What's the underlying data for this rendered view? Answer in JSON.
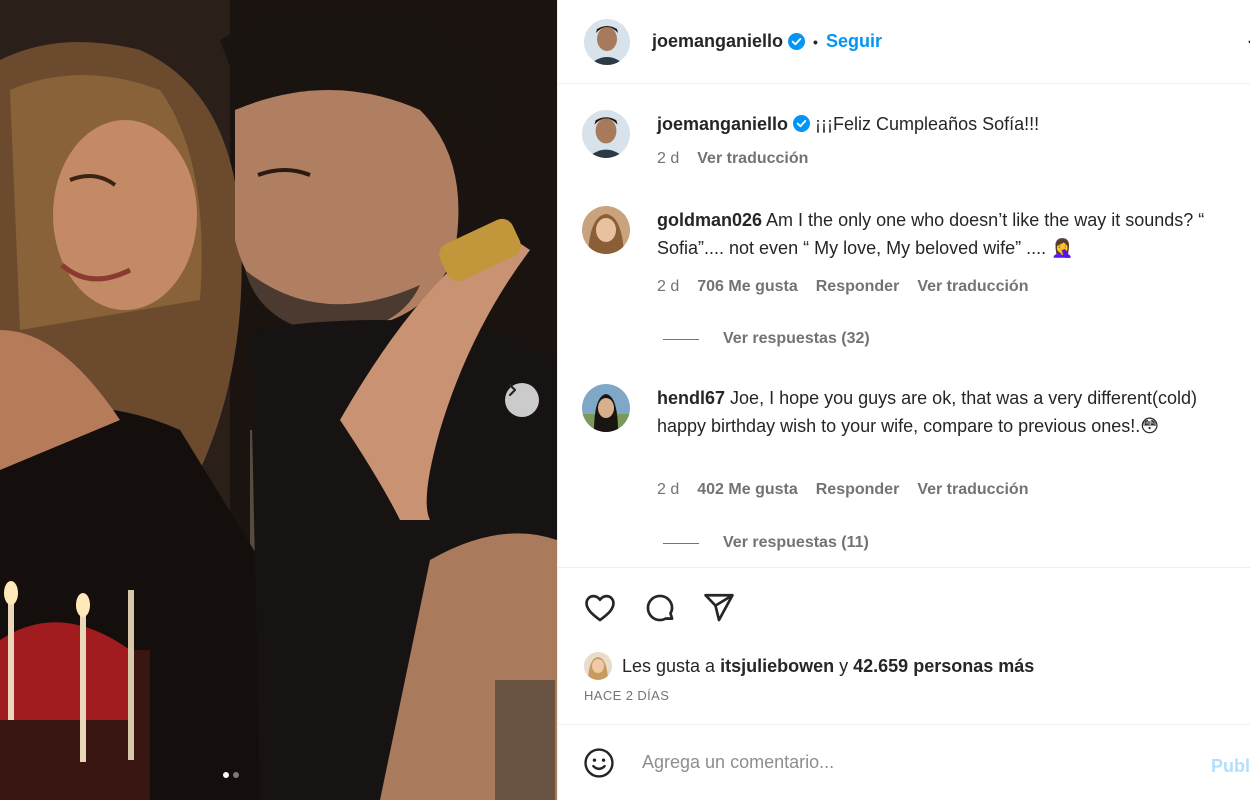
{
  "post": {
    "author": "joemanganiello",
    "verified": true,
    "follow_label": "Seguir",
    "separator": "•",
    "carousel_dots": 2,
    "caption": {
      "author": "joemanganiello",
      "text": "¡¡¡Feliz Cumpleaños Sofía!!!",
      "time": "2 d",
      "translate": "Ver traducción"
    }
  },
  "comments": [
    {
      "author": "goldman026",
      "text": "Am I the only one who doesn’t like the way it sounds? “ Sofia”.... not even “ My love, My beloved wife” .... 🤦‍♀️",
      "time": "2 d",
      "likes": "706 Me gusta",
      "reply": "Responder",
      "translate": "Ver traducción",
      "view_replies": "Ver respuestas (32)"
    },
    {
      "author": "hendl67",
      "text": "Joe, I hope you guys are ok, that was a very different(cold) happy birthday wish to your wife, compare to previous ones!.😳",
      "time": "2 d",
      "likes": "402 Me gusta",
      "reply": "Responder",
      "translate": "Ver traducción",
      "view_replies": "Ver respuestas (11)"
    }
  ],
  "likes": {
    "prefix": "Les gusta a",
    "user": "itsjuliebowen",
    "connector": "y",
    "others": "42.659 personas más"
  },
  "date_label": "HACE 2 DÍAS",
  "add_comment": {
    "placeholder": "Agrega un comentario...",
    "publish": "Publi"
  },
  "icons": [
    "heart-icon",
    "comment-icon",
    "share-icon",
    "emoji-icon",
    "verified-icon",
    "chevron-right-icon"
  ],
  "colors": {
    "accent": "#0095f6",
    "muted": "#737373",
    "publish_disabled": "#b2dffc"
  }
}
